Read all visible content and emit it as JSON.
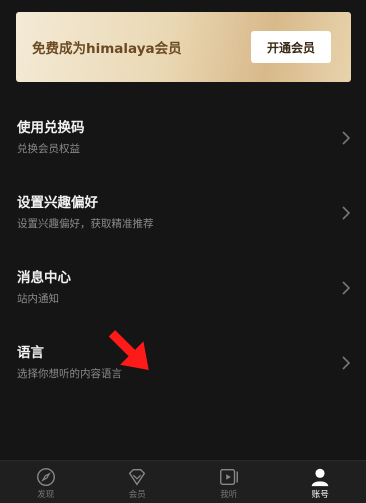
{
  "vip": {
    "text": "免费成为himalaya会员",
    "button": "开通会员"
  },
  "menu": [
    {
      "title": "使用兑换码",
      "subtitle": "兑换会员权益"
    },
    {
      "title": "设置兴趣偏好",
      "subtitle": "设置兴趣偏好，获取精准推荐"
    },
    {
      "title": "消息中心",
      "subtitle": "站内通知"
    },
    {
      "title": "语言",
      "subtitle": "选择你想听的内容语言"
    }
  ],
  "tabbar": [
    {
      "label": "发现",
      "icon": "compass-icon"
    },
    {
      "label": "会员",
      "icon": "diamond-icon"
    },
    {
      "label": "我听",
      "icon": "player-icon"
    },
    {
      "label": "账号",
      "icon": "person-icon",
      "active": true
    }
  ],
  "annotation": {
    "arrow_color": "#ff1a1a"
  }
}
